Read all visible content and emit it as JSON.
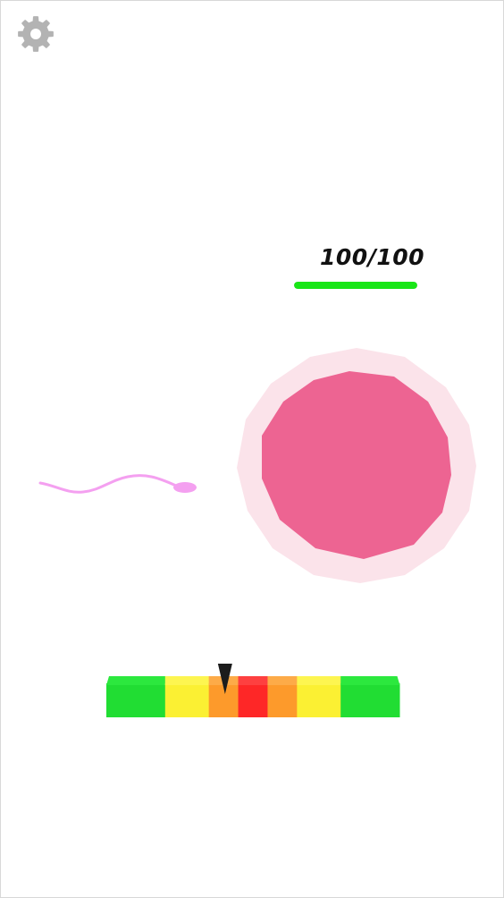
{
  "settings": {
    "icon": "gear-icon",
    "color": "#b3b3b3"
  },
  "health": {
    "current": "100",
    "separator": "/",
    "max": "100",
    "fraction": 1.0,
    "bar_color": "#19e617"
  },
  "egg": {
    "outer_color": "#fbe3ea",
    "inner_color": "#ed6492"
  },
  "sperm": {
    "color": "#f4a0f0"
  },
  "power_meter": {
    "segments": [
      {
        "zone": "green",
        "color": "#21dd33",
        "top": "#2ce83e"
      },
      {
        "zone": "yellow",
        "color": "#fbf033",
        "top": "#fdf550"
      },
      {
        "zone": "orange",
        "color": "#fd9a2b",
        "top": "#fdab48"
      },
      {
        "zone": "red",
        "color": "#fe2727",
        "top": "#fe4040"
      },
      {
        "zone": "orange",
        "color": "#fd9a2b",
        "top": "#fdab48"
      },
      {
        "zone": "yellow",
        "color": "#fbf033",
        "top": "#fdf550"
      },
      {
        "zone": "green",
        "color": "#21dd33",
        "top": "#2ce83e"
      }
    ],
    "segment_weights": [
      66,
      49,
      33,
      33,
      33,
      49,
      66
    ],
    "pointer_position": 0.405,
    "pointer_color": "#1c1c1c"
  }
}
